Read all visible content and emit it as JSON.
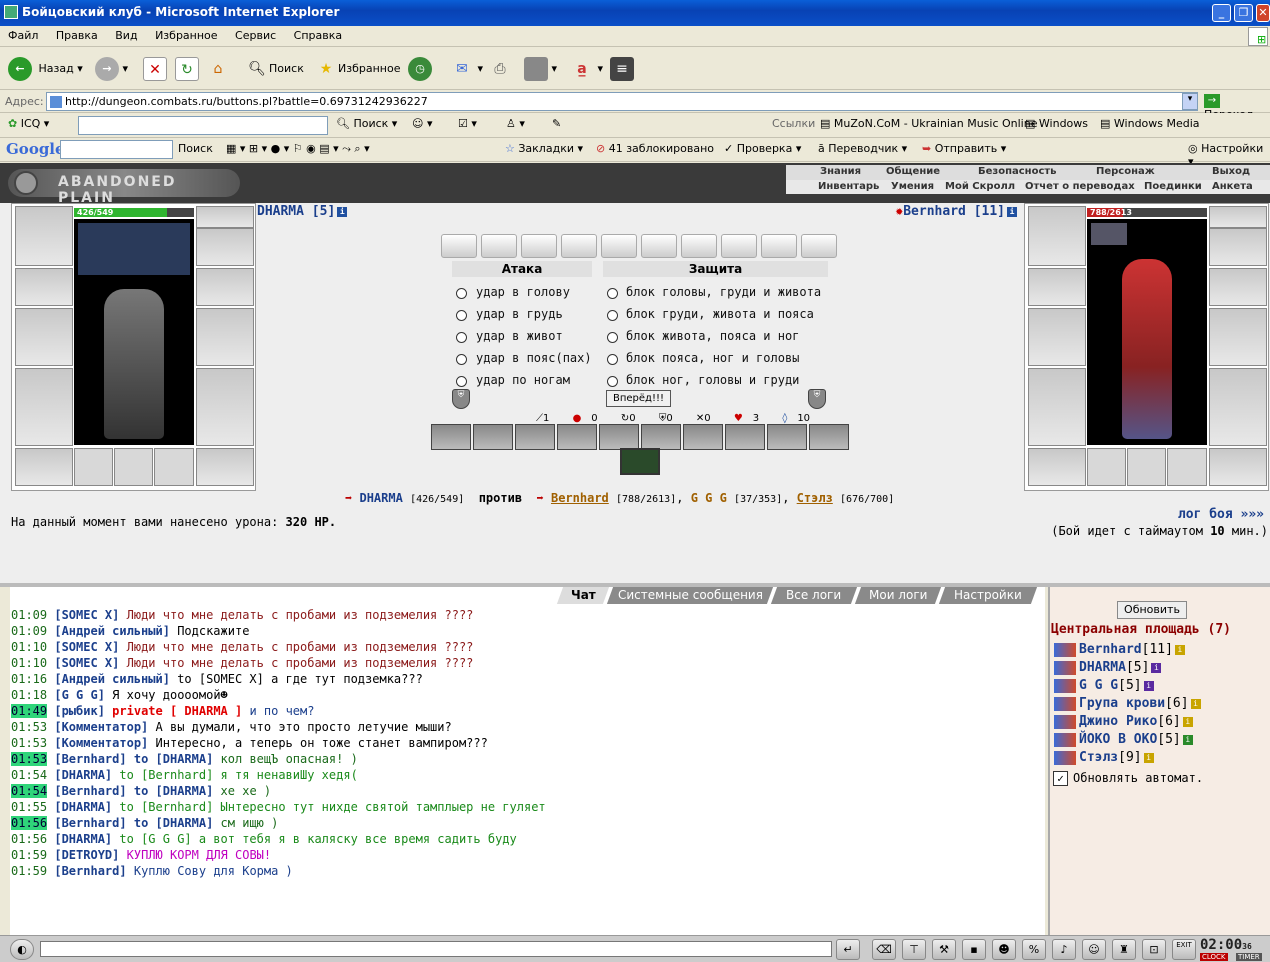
{
  "window": {
    "title": "Бойцовский клуб - Microsoft Internet Explorer"
  },
  "menu": [
    "Файл",
    "Правка",
    "Вид",
    "Избранное",
    "Сервис",
    "Справка"
  ],
  "toolbar": {
    "back": "Назад",
    "search": "Поиск",
    "favorites": "Избранное"
  },
  "address": {
    "label": "Адрес:",
    "url": "http://dungeon.combats.ru/buttons.pl?battle=0.69731242936227",
    "go": "Переход"
  },
  "icqbar": {
    "icq": "ICQ",
    "search": "Поиск",
    "links": "Ссылки",
    "link1": "MuZoN.CoM - Ukrainian Music Online",
    "link2": "Windows",
    "link3": "Windows Media"
  },
  "googlebar": {
    "logo": "Google",
    "search": "Поиск",
    "bookmarks": "Закладки",
    "blocked": "41 заблокировано",
    "check": "Проверка",
    "translator": "Переводчик",
    "send": "Отправить",
    "settings": "Настройки"
  },
  "game": {
    "logo": "ABANDONED PLAIN",
    "nav1": [
      "Знания",
      "Общение",
      "Безопасность",
      "Персонаж",
      "Выход"
    ],
    "nav2": [
      "Инвентарь",
      "Умения",
      "Мой Скролл",
      "Отчет о переводах",
      "Поединки",
      "Анкета"
    ]
  },
  "player": {
    "name": "DHARMA",
    "level": "[5]",
    "hp": "426/549",
    "hp_fraction": 0.776
  },
  "enemy": {
    "name": "Bernhard",
    "level": "[11]",
    "hp": "788/2613",
    "hp_fraction": 0.302
  },
  "combat": {
    "attack_title": "Атака",
    "defense_title": "Защита",
    "attacks": [
      "удар в голову",
      "удар в грудь",
      "удар в живот",
      "удар в пояс(пах)",
      "удар по ногам"
    ],
    "blocks": [
      "блок головы, груди и живота",
      "блок груди, живота и пояса",
      "блок живота, пояса и ног",
      "блок пояса, ног и головы",
      "блок ног, головы и груди"
    ],
    "forward": "Вперёд!!!",
    "stats": [
      "1",
      "0",
      "0",
      "0",
      "0",
      "3",
      "10"
    ]
  },
  "vs": {
    "p1": "DHARMA",
    "p1hp": "[426/549]",
    "against": "против",
    "e1": "Bernhard",
    "e1hp": "[788/2613]",
    "e2": "G G G",
    "e2hp": "[37/353]",
    "e3": "Стэлз",
    "e3hp": "[676/700]"
  },
  "damage": {
    "text": "На данный момент вами нанесено урона:",
    "value": "320 HP."
  },
  "log": {
    "link": "лог боя »»»",
    "timeout_pre": "(Бой идет с таймаутом",
    "timeout_val": "10",
    "timeout_post": "мин.)"
  },
  "tabs": [
    "Чат",
    "Системные сообщения",
    "Все логи",
    "Мои логи",
    "Настройки"
  ],
  "chat": [
    {
      "t": "01:09",
      "hl": false,
      "nick": "[SOMEC X]",
      "text": "Люди что мне делать с пробами из подземелия ????",
      "color": "#8b1a1a"
    },
    {
      "t": "01:09",
      "hl": false,
      "nick": "[Андрей сильный]",
      "text": "Подскажите",
      "color": "#000000"
    },
    {
      "t": "01:10",
      "hl": false,
      "nick": "[SOMEC X]",
      "text": "Люди что мне делать с пробами из подземелия ????",
      "color": "#8b1a1a"
    },
    {
      "t": "01:10",
      "hl": false,
      "nick": "[SOMEC X]",
      "text": "Люди что мне делать с пробами из подземелия ????",
      "color": "#8b1a1a"
    },
    {
      "t": "01:16",
      "hl": false,
      "nick": "[Андрей сильный]",
      "text": "to [SOMEC X] а где тут подземка???",
      "color": "#000000"
    },
    {
      "t": "01:18",
      "hl": false,
      "nick": "[G G G]",
      "text": "Я хочу доооомой☻",
      "color": "#000000"
    },
    {
      "t": "01:49",
      "hl": true,
      "nick": "[рыбик]",
      "pre": "private [ DHARMA ]",
      "text": " и по чем?",
      "color": "#1b3f8c"
    },
    {
      "t": "01:53",
      "hl": false,
      "nick": "[Комментатор]",
      "text": "А вы думали, что это просто летучие мыши?",
      "color": "#000000"
    },
    {
      "t": "01:53",
      "hl": false,
      "nick": "[Комментатор]",
      "text": "Интересно, а теперь он тоже станет вампиром???",
      "color": "#000000"
    },
    {
      "t": "01:53",
      "hl": true,
      "nick": "[Bernhard]",
      "to": "to [DHARMA]",
      "text": " кол вещЪ опасная! )",
      "color": "#1a6a1a"
    },
    {
      "t": "01:54",
      "hl": false,
      "nick": "[DHARMA]",
      "text": "to [Bernhard] я тя ненавиШу хедя(",
      "color": "#1a8a1a"
    },
    {
      "t": "01:54",
      "hl": true,
      "nick": "[Bernhard]",
      "to": "to [DHARMA]",
      "text": " хе хе )",
      "color": "#1a6a1a"
    },
    {
      "t": "01:55",
      "hl": false,
      "nick": "[DHARMA]",
      "text": "to [Bernhard] Ынтересно тут нихде святой тамплыер не гуляет",
      "color": "#1a8a1a"
    },
    {
      "t": "01:56",
      "hl": true,
      "nick": "[Bernhard]",
      "to": "to [DHARMA]",
      "text": " см ищю )",
      "color": "#1a6a1a"
    },
    {
      "t": "01:56",
      "hl": false,
      "nick": "[DHARMA]",
      "text": "to [G G G] а вот тебя я в каляску все время садить буду",
      "color": "#1a8a1a"
    },
    {
      "t": "01:59",
      "hl": false,
      "nick": "[DETROYD]",
      "text": "КУПЛЮ КОРМ ДЛЯ СОВЫ!",
      "color": "#c000c0"
    },
    {
      "t": "01:59",
      "hl": false,
      "nick": "[Bernhard]",
      "text": "Куплю Сову для Корма )",
      "color": "#1b3f8c"
    }
  ],
  "room": {
    "refresh": "Обновить",
    "title": "Центральная площадь (7)",
    "players": [
      {
        "name": "Bernhard",
        "level": "[11]",
        "info": "y"
      },
      {
        "name": "DHARMA",
        "level": "[5]",
        "info": "p"
      },
      {
        "name": "G G G",
        "level": "[5]",
        "info": "p"
      },
      {
        "name": "Група крови",
        "level": "[6]",
        "info": "y"
      },
      {
        "name": "Джино Рико",
        "level": "[6]",
        "info": "y"
      },
      {
        "name": "ЙОКО В ОКО",
        "level": "[5]",
        "info": "g"
      },
      {
        "name": "Стэлз",
        "level": "[9]",
        "info": "y"
      }
    ],
    "auto": "Обновлять автомат."
  },
  "bottom": {
    "clock": "02:00",
    "seconds": "36",
    "clock_label": "CLOCK",
    "timer_label": "TIMER",
    "exit": "EXIT"
  }
}
